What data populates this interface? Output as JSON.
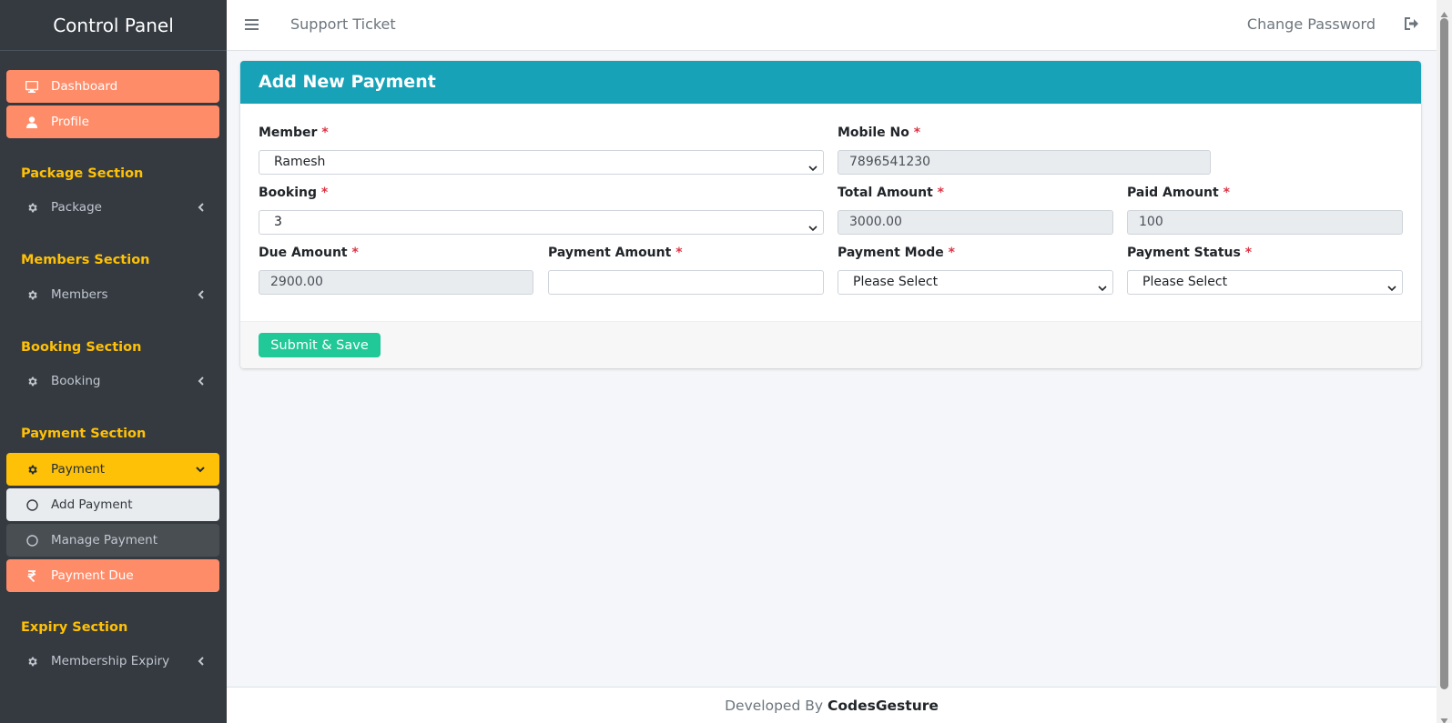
{
  "sidebar": {
    "brand": "Control Panel",
    "dashboard": "Dashboard",
    "profile": "Profile",
    "sections": {
      "package": {
        "header": "Package Section",
        "item": "Package"
      },
      "members": {
        "header": "Members Section",
        "item": "Members"
      },
      "booking": {
        "header": "Booking Section",
        "item": "Booking"
      },
      "payment": {
        "header": "Payment Section",
        "item": "Payment",
        "sub": [
          "Add Payment",
          "Manage Payment"
        ],
        "due": "Payment Due"
      },
      "expiry": {
        "header": "Expiry Section",
        "item": "Membership Expiry"
      }
    }
  },
  "topnav": {
    "support": "Support Ticket",
    "change_password": "Change Password"
  },
  "form": {
    "title": "Add New Payment",
    "member": {
      "label": "Member",
      "value": "Ramesh"
    },
    "mobile": {
      "label": "Mobile No",
      "value": "7896541230"
    },
    "booking": {
      "label": "Booking",
      "value": "3"
    },
    "total_amount": {
      "label": "Total Amount",
      "value": "3000.00"
    },
    "paid_amount": {
      "label": "Paid Amount",
      "value": "100"
    },
    "due_amount": {
      "label": "Due Amount",
      "value": "2900.00"
    },
    "payment_amount": {
      "label": "Payment Amount",
      "value": ""
    },
    "payment_mode": {
      "label": "Payment Mode",
      "value": "Please Select"
    },
    "payment_status": {
      "label": "Payment Status",
      "value": "Please Select"
    },
    "required_mark": "*",
    "submit": "Submit & Save"
  },
  "footer": {
    "prefix": "Developed By",
    "brand": "CodesGesture"
  },
  "colors": {
    "sidebar": "#343a40",
    "orange": "#ff8c69",
    "yellow": "#ffc107",
    "header": "#17a2b8",
    "submit": "#20c997"
  }
}
